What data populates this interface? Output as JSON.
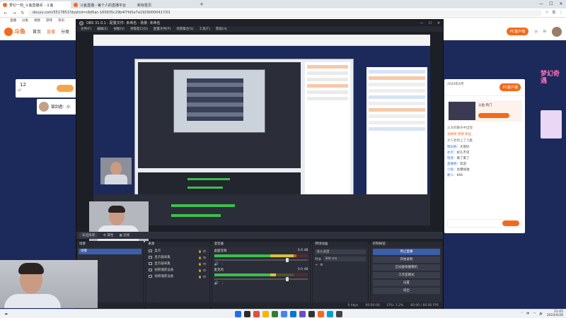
{
  "browser": {
    "tabs": [
      {
        "label": "梦幻一刻_斗鱼直播间 - 斗鱼",
        "active": true
      },
      {
        "label": "斗鱼直播 - 每个人的直播平台",
        "active": false
      },
      {
        "label": "新标签页",
        "active": false
      }
    ],
    "url": "douyu.com/5517851?dyshid=c8d5ac-160935c29b4f7fd5e7a19290000417/01",
    "bookmarks": [
      "直播",
      "分类",
      "视频",
      "游戏",
      "资讯"
    ]
  },
  "douyu": {
    "logo_text": "斗鱼",
    "nav": [
      "首页",
      "直播",
      "分类"
    ],
    "pc_button": "PC客户端",
    "left_num": "12",
    "left_level": "LV",
    "left_name": "锦剑君：小"
  },
  "right_panel": {
    "date": "2024年4月",
    "pc_label": "PC客户端",
    "card_title": "斗鱼·热门",
    "lines": [
      {
        "text": "火大的聊天中出现",
        "hl": false
      },
      {
        "text": "贡献榜 周榜 粉丝",
        "hl": true
      },
      {
        "text": "大人老师上了几集",
        "hl": false
      }
    ],
    "messages": [
      {
        "user": "锦剑君",
        "text": "：大佬好"
      },
      {
        "user": "亦可",
        "text": "：好久不见"
      },
      {
        "user": "暗夜",
        "text": "：来了来了"
      },
      {
        "user": "直播君",
        "text": "：欢迎"
      },
      {
        "user": "小鱼",
        "text": "：主播加油"
      },
      {
        "user": "路人",
        "text": "：666"
      }
    ]
  },
  "promo": {
    "text": "梦幻奇遇"
  },
  "obs": {
    "title": "OBS 31.0.1 - 配置文件: 未命名 - 场景: 未命名",
    "menu": [
      "文件(F)",
      "编辑(E)",
      "视图(V)",
      "停靠窗口(D)",
      "配置文件(P)",
      "场景集合(S)",
      "工具(T)",
      "帮助(H)"
    ],
    "source_bar": {
      "source": "未选择源",
      "properties": "属性",
      "filters": "滤镜"
    },
    "scenes": {
      "title": "场景",
      "items": [
        "场景"
      ]
    },
    "sources": {
      "title": "来源",
      "items": [
        "显示",
        "显示器采集",
        "显示器采集",
        "视频捕获设备",
        "视频捕获设备"
      ]
    },
    "mixer": {
      "title": "混音器",
      "channels": [
        {
          "name": "桌面音频",
          "db": "0.0 dB",
          "level": 0.88,
          "volume": 0.78
        },
        {
          "name": "麦克风",
          "db": "0.0 dB",
          "level": 0.66,
          "volume": 0.78
        }
      ]
    },
    "transitions": {
      "title": "转场动画",
      "type": "淡入淡出",
      "duration_label": "时长",
      "duration": "300 ms"
    },
    "controls": {
      "title": "控制按钮",
      "buttons": [
        "停止直播",
        "开始录制",
        "启动虚拟摄像机",
        "工作室模式",
        "设置",
        "退出"
      ]
    },
    "status": {
      "cpu": "CPU: 1.2%",
      "fps": "60.00 / 60.00 FPS",
      "time": "00:00:00",
      "kbps": "0 kbps"
    }
  },
  "taskbar": {
    "time": "21:05",
    "date": "2024/4/28",
    "lang": "中",
    "icon_colors": [
      "#1f6feb",
      "#2b2b2b",
      "#e74c3c",
      "#f5b700",
      "#2e7d32",
      "#4285f4",
      "#0078d4",
      "#6b4fbb",
      "#333333",
      "#f26b1d",
      "#00a1d6",
      "#444444"
    ]
  }
}
